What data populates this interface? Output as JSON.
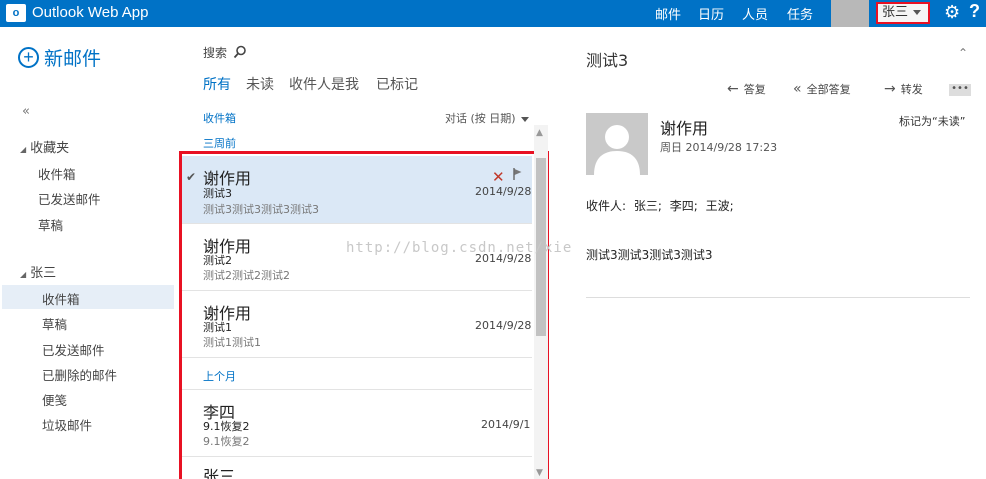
{
  "app": {
    "title": "Outlook Web App",
    "logo_text": "o"
  },
  "topnav": {
    "items": [
      {
        "label": "邮件"
      },
      {
        "label": "日历"
      },
      {
        "label": "人员"
      },
      {
        "label": "任务"
      }
    ],
    "user_name": "张三"
  },
  "sidebar": {
    "new_mail_label": "新邮件",
    "collapse_symbol": "«",
    "favorites": {
      "title": "收藏夹",
      "items": [
        {
          "label": "收件箱"
        },
        {
          "label": "已发送邮件"
        },
        {
          "label": "草稿"
        }
      ]
    },
    "account": {
      "title": "张三",
      "items": [
        {
          "label": "收件箱",
          "selected": true
        },
        {
          "label": "草稿"
        },
        {
          "label": "已发送邮件"
        },
        {
          "label": "已删除的邮件"
        },
        {
          "label": "便笺"
        },
        {
          "label": "垃圾邮件"
        }
      ]
    }
  },
  "list": {
    "search_label": "搜索",
    "filters": [
      {
        "label": "所有"
      },
      {
        "label": "未读"
      },
      {
        "label": "收件人是我"
      },
      {
        "label": "已标记"
      }
    ],
    "folder_label": "收件箱",
    "sort_label": "对话 (按 日期)",
    "groups": [
      {
        "header": "三周前"
      },
      {
        "header": "上个月"
      }
    ],
    "messages": [
      {
        "sender": "谢作用",
        "subject": "测试3",
        "preview": "测试3测试3测试3测试3",
        "date": "2014/9/28"
      },
      {
        "sender": "谢作用",
        "subject": "测试2",
        "preview": "测试2测试2测试2",
        "date": "2014/9/28"
      },
      {
        "sender": "谢作用",
        "subject": "测试1",
        "preview": "测试1测试1",
        "date": "2014/9/28"
      },
      {
        "sender": "李四",
        "subject": "9.1恢复2",
        "preview": "9.1恢复2",
        "date": "2014/9/1"
      },
      {
        "sender": "张三"
      }
    ]
  },
  "reading": {
    "subject": "测试3",
    "actions": {
      "reply": "答复",
      "reply_all": "全部答复",
      "forward": "转发",
      "more": "•••"
    },
    "sender": "谢作用",
    "date": "周日 2014/9/28 17:23",
    "mark_unread": "标记为“未读”",
    "recipients_label": "收件人:",
    "recipients": [
      "张三;",
      "李四;",
      "王波;"
    ],
    "body": "测试3测试3测试3测试3"
  },
  "watermark": "http://blog.csdn.net/xie",
  "colors": {
    "brand_blue": "#0072c6",
    "highlight_red": "#e81123",
    "selected_bg": "#dbe8f6"
  }
}
